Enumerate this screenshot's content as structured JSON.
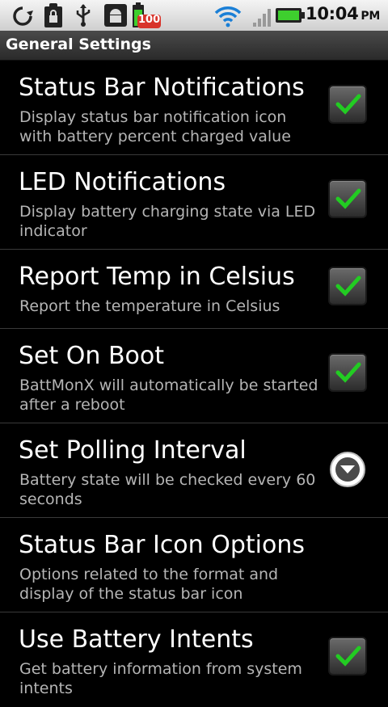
{
  "status_bar": {
    "icons": [
      "sync-icon",
      "clipboard-lock-icon",
      "usb-icon",
      "android-debug-icon",
      "battery-notification-icon"
    ],
    "battery_badge": "100",
    "time": "10:04",
    "ampm": "PM"
  },
  "title_bar": {
    "title": "General Settings"
  },
  "settings": [
    {
      "title": "Status Bar Notifications",
      "summary": "Display status bar notification icon with battery percent charged value",
      "control": "checkbox",
      "checked": true
    },
    {
      "title": "LED Notifications",
      "summary": "Display battery charging state via LED indicator",
      "control": "checkbox",
      "checked": true
    },
    {
      "title": "Report Temp in Celsius",
      "summary": "Report the temperature in Celsius",
      "control": "checkbox",
      "checked": true
    },
    {
      "title": "Set On Boot",
      "summary": "BattMonX will automatically be started after a reboot",
      "control": "checkbox",
      "checked": true
    },
    {
      "title": "Set Polling Interval",
      "summary": "Battery state will be checked every 60 seconds",
      "control": "dropdown"
    },
    {
      "title": "Status Bar Icon Options",
      "summary": "Options related to the format and display of the status bar icon",
      "control": "none"
    },
    {
      "title": "Use Battery Intents",
      "summary": "Get battery information from system intents",
      "control": "checkbox",
      "checked": true
    }
  ],
  "colors": {
    "check_green": "#22cc22",
    "battery_green": "#3ecf2e",
    "badge_red": "#d8332a",
    "wifi_blue": "#1a7fd6"
  }
}
